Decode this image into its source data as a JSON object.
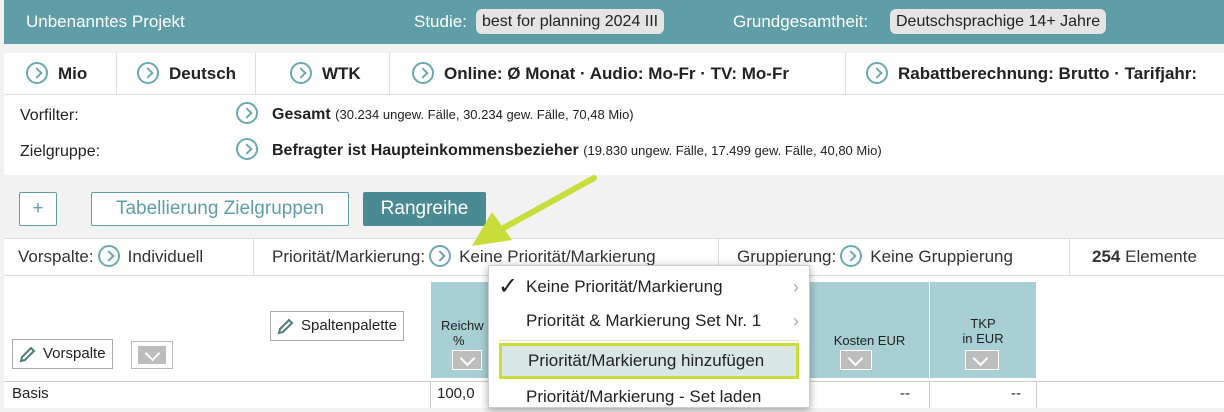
{
  "header": {
    "project_name": "Unbenanntes Projekt",
    "study_label": "Studie:",
    "study_value": "best for planning 2024 III",
    "population_label": "Grundgesamtheit:",
    "population_value": "Deutschsprachige 14+ Jahre"
  },
  "tabs": [
    {
      "label": "Mio"
    },
    {
      "label": "Deutsch"
    },
    {
      "label": "WTK"
    },
    {
      "label": "Online: Ø Monat · Audio: Mo-Fr · TV: Mo-Fr"
    },
    {
      "label": "Rabattberechnung: Brutto · Tarifjahr:"
    }
  ],
  "filters": {
    "prefilter_label": "Vorfilter:",
    "prefilter_value": "Gesamt",
    "prefilter_detail": "(30.234 ungew. Fälle, 30.234 gew. Fälle, 70,48 Mio)",
    "target_label": "Zielgruppe:",
    "target_value": "Befragter ist Haupteinkommensbezieher",
    "target_detail": "(19.830 ungew. Fälle, 17.499 gew. Fälle, 40,80 Mio)"
  },
  "toolbar": {
    "add_label": "+",
    "tabulation_label": "Tabellierung Zielgruppen",
    "ranking_label": "Rangreihe"
  },
  "status": {
    "column_label": "Vorspalte:",
    "column_value": "Individuell",
    "priority_label": "Priorität/Markierung:",
    "priority_value": "Keine Priorität/Markierung",
    "grouping_label": "Gruppierung:",
    "grouping_value": "Keine Gruppierung",
    "count": "254",
    "count_suffix": "Elemente"
  },
  "table": {
    "column_palette_label": "Spaltenpalette",
    "front_column_label": "Vorspalte",
    "columns": [
      {
        "label_line1": "Reichw",
        "label_line2": "%"
      },
      {
        "label_line1": "Kosten EUR",
        "label_line2": ""
      },
      {
        "label_line1": "TKP",
        "label_line2": "in EUR"
      }
    ],
    "rows": [
      {
        "name": "Basis",
        "reach": "100,0",
        "cost": "--",
        "tkp": "--"
      }
    ]
  },
  "menu": {
    "items": [
      {
        "label": "Keine Priorität/Markierung",
        "checked": true,
        "submenu": true
      },
      {
        "label": "Priorität & Markierung Set Nr. 1",
        "checked": false,
        "submenu": true
      },
      {
        "label": "Priorität/Markierung hinzufügen",
        "highlighted": true
      },
      {
        "label": "Priorität/Markierung - Set laden"
      }
    ]
  },
  "colors": {
    "accent": "#5f9ea6",
    "header_bg": "#5f9ea6",
    "column_header_bg": "#a8cfd3",
    "highlight_border": "#c8dc3a",
    "arrow": "#c8dc3a"
  }
}
